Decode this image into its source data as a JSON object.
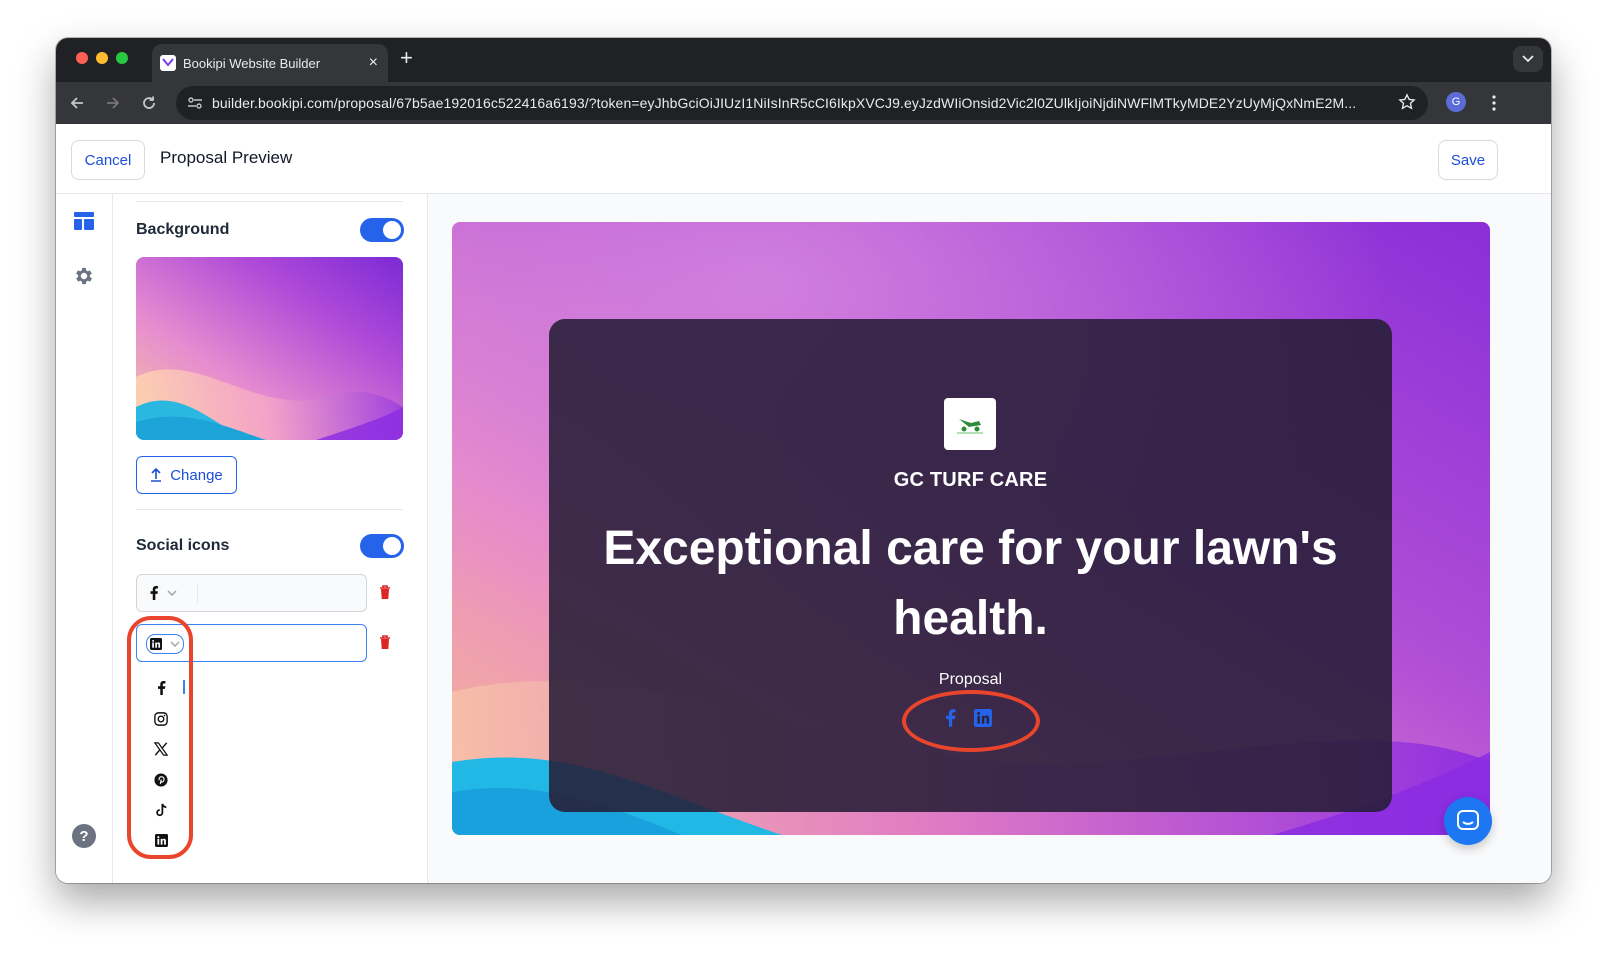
{
  "browser": {
    "tab_title": "Bookipi Website Builder",
    "tab_close": "×",
    "new_tab": "+",
    "url": "builder.bookipi.com/proposal/67b5ae192016c522416a6193/?token=eyJhbGciOiJIUzI1NiIsInR5cCI6IkpXVCJ9.eyJzdWIiOnsid2Vic2l0ZUlkIjoiNjdiNWFlMTkyMDE2YzUyMjQxNmE2M...",
    "profile_initial": "G"
  },
  "header": {
    "cancel_label": "Cancel",
    "title": "Proposal Preview",
    "save_label": "Save"
  },
  "rail": {
    "icons": [
      "layout-icon",
      "settings-gear-icon",
      "help-icon"
    ]
  },
  "panel": {
    "background": {
      "title": "Background",
      "enabled": true,
      "change_label": "Change"
    },
    "social": {
      "title": "Social icons",
      "enabled": true,
      "entries": [
        {
          "icon": "facebook-icon",
          "value": ""
        },
        {
          "icon": "linkedin-icon",
          "value": ""
        }
      ],
      "dropdown_options": [
        "facebook-icon",
        "instagram-icon",
        "x-twitter-icon",
        "pinterest-icon",
        "tiktok-icon",
        "linkedin-icon"
      ]
    }
  },
  "preview": {
    "company": "GC TURF CARE",
    "headline": "Exceptional care for your lawn's health.",
    "label": "Proposal",
    "social_icons": [
      "facebook-icon",
      "linkedin-icon"
    ]
  },
  "colors": {
    "accent": "#2563eb",
    "annotation": "#e8452c",
    "card": "#261e37"
  }
}
